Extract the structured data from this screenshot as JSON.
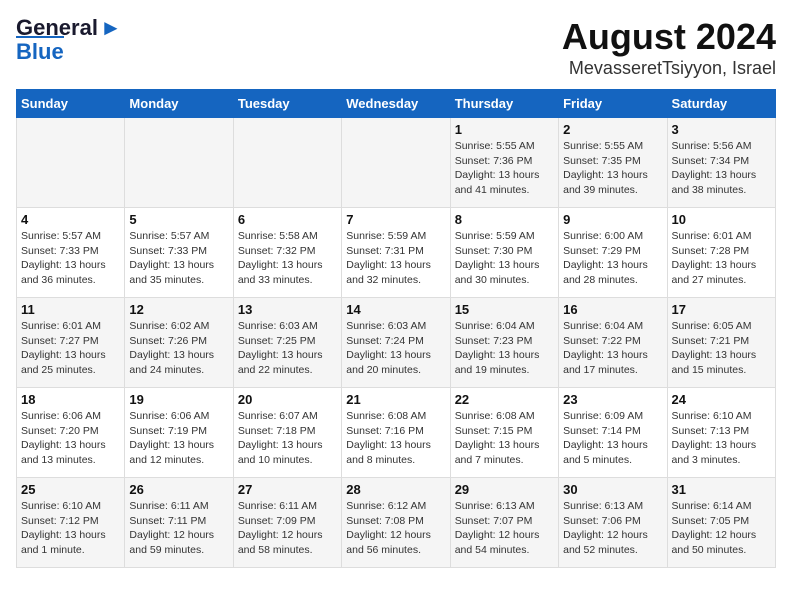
{
  "header": {
    "logo_line1": "General",
    "logo_line2": "Blue",
    "title": "August 2024",
    "subtitle": "MevasseretTsiyyon, Israel"
  },
  "days_of_week": [
    "Sunday",
    "Monday",
    "Tuesday",
    "Wednesday",
    "Thursday",
    "Friday",
    "Saturday"
  ],
  "weeks": [
    [
      {
        "day": "",
        "info": ""
      },
      {
        "day": "",
        "info": ""
      },
      {
        "day": "",
        "info": ""
      },
      {
        "day": "",
        "info": ""
      },
      {
        "day": "1",
        "info": "Sunrise: 5:55 AM\nSunset: 7:36 PM\nDaylight: 13 hours\nand 41 minutes."
      },
      {
        "day": "2",
        "info": "Sunrise: 5:55 AM\nSunset: 7:35 PM\nDaylight: 13 hours\nand 39 minutes."
      },
      {
        "day": "3",
        "info": "Sunrise: 5:56 AM\nSunset: 7:34 PM\nDaylight: 13 hours\nand 38 minutes."
      }
    ],
    [
      {
        "day": "4",
        "info": "Sunrise: 5:57 AM\nSunset: 7:33 PM\nDaylight: 13 hours\nand 36 minutes."
      },
      {
        "day": "5",
        "info": "Sunrise: 5:57 AM\nSunset: 7:33 PM\nDaylight: 13 hours\nand 35 minutes."
      },
      {
        "day": "6",
        "info": "Sunrise: 5:58 AM\nSunset: 7:32 PM\nDaylight: 13 hours\nand 33 minutes."
      },
      {
        "day": "7",
        "info": "Sunrise: 5:59 AM\nSunset: 7:31 PM\nDaylight: 13 hours\nand 32 minutes."
      },
      {
        "day": "8",
        "info": "Sunrise: 5:59 AM\nSunset: 7:30 PM\nDaylight: 13 hours\nand 30 minutes."
      },
      {
        "day": "9",
        "info": "Sunrise: 6:00 AM\nSunset: 7:29 PM\nDaylight: 13 hours\nand 28 minutes."
      },
      {
        "day": "10",
        "info": "Sunrise: 6:01 AM\nSunset: 7:28 PM\nDaylight: 13 hours\nand 27 minutes."
      }
    ],
    [
      {
        "day": "11",
        "info": "Sunrise: 6:01 AM\nSunset: 7:27 PM\nDaylight: 13 hours\nand 25 minutes."
      },
      {
        "day": "12",
        "info": "Sunrise: 6:02 AM\nSunset: 7:26 PM\nDaylight: 13 hours\nand 24 minutes."
      },
      {
        "day": "13",
        "info": "Sunrise: 6:03 AM\nSunset: 7:25 PM\nDaylight: 13 hours\nand 22 minutes."
      },
      {
        "day": "14",
        "info": "Sunrise: 6:03 AM\nSunset: 7:24 PM\nDaylight: 13 hours\nand 20 minutes."
      },
      {
        "day": "15",
        "info": "Sunrise: 6:04 AM\nSunset: 7:23 PM\nDaylight: 13 hours\nand 19 minutes."
      },
      {
        "day": "16",
        "info": "Sunrise: 6:04 AM\nSunset: 7:22 PM\nDaylight: 13 hours\nand 17 minutes."
      },
      {
        "day": "17",
        "info": "Sunrise: 6:05 AM\nSunset: 7:21 PM\nDaylight: 13 hours\nand 15 minutes."
      }
    ],
    [
      {
        "day": "18",
        "info": "Sunrise: 6:06 AM\nSunset: 7:20 PM\nDaylight: 13 hours\nand 13 minutes."
      },
      {
        "day": "19",
        "info": "Sunrise: 6:06 AM\nSunset: 7:19 PM\nDaylight: 13 hours\nand 12 minutes."
      },
      {
        "day": "20",
        "info": "Sunrise: 6:07 AM\nSunset: 7:18 PM\nDaylight: 13 hours\nand 10 minutes."
      },
      {
        "day": "21",
        "info": "Sunrise: 6:08 AM\nSunset: 7:16 PM\nDaylight: 13 hours\nand 8 minutes."
      },
      {
        "day": "22",
        "info": "Sunrise: 6:08 AM\nSunset: 7:15 PM\nDaylight: 13 hours\nand 7 minutes."
      },
      {
        "day": "23",
        "info": "Sunrise: 6:09 AM\nSunset: 7:14 PM\nDaylight: 13 hours\nand 5 minutes."
      },
      {
        "day": "24",
        "info": "Sunrise: 6:10 AM\nSunset: 7:13 PM\nDaylight: 13 hours\nand 3 minutes."
      }
    ],
    [
      {
        "day": "25",
        "info": "Sunrise: 6:10 AM\nSunset: 7:12 PM\nDaylight: 13 hours\nand 1 minute."
      },
      {
        "day": "26",
        "info": "Sunrise: 6:11 AM\nSunset: 7:11 PM\nDaylight: 12 hours\nand 59 minutes."
      },
      {
        "day": "27",
        "info": "Sunrise: 6:11 AM\nSunset: 7:09 PM\nDaylight: 12 hours\nand 58 minutes."
      },
      {
        "day": "28",
        "info": "Sunrise: 6:12 AM\nSunset: 7:08 PM\nDaylight: 12 hours\nand 56 minutes."
      },
      {
        "day": "29",
        "info": "Sunrise: 6:13 AM\nSunset: 7:07 PM\nDaylight: 12 hours\nand 54 minutes."
      },
      {
        "day": "30",
        "info": "Sunrise: 6:13 AM\nSunset: 7:06 PM\nDaylight: 12 hours\nand 52 minutes."
      },
      {
        "day": "31",
        "info": "Sunrise: 6:14 AM\nSunset: 7:05 PM\nDaylight: 12 hours\nand 50 minutes."
      }
    ]
  ]
}
